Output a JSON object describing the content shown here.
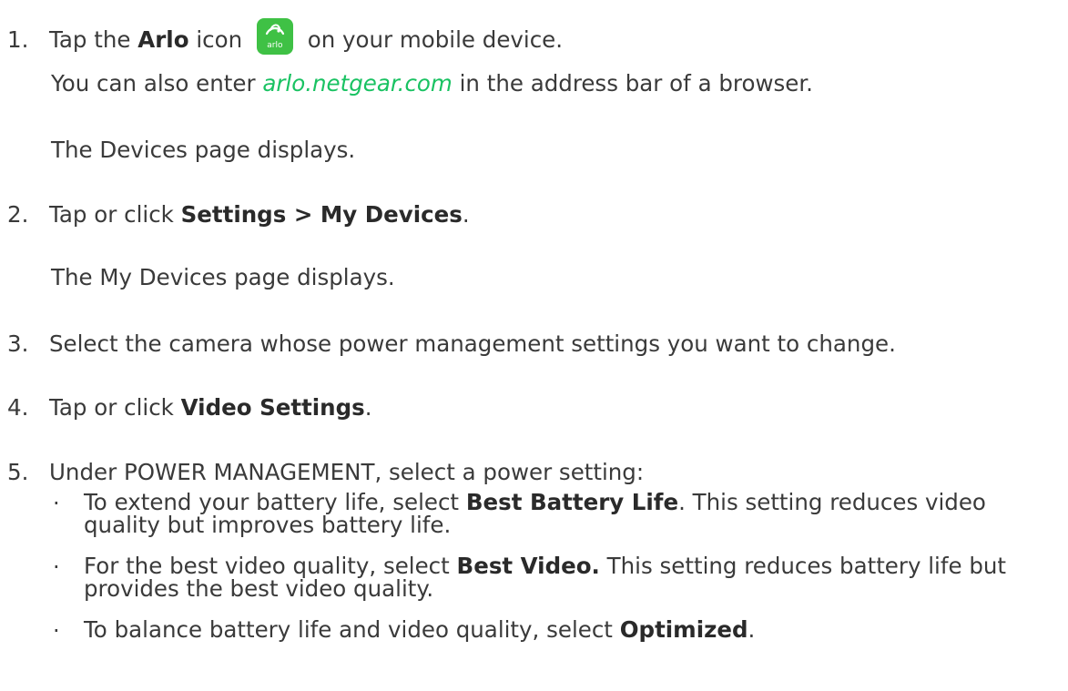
{
  "step1": {
    "number": "1.",
    "before": "Tap the ",
    "bold": "Arlo",
    "middle": " icon ",
    "icon_label": "arlo",
    "after": " on your mobile device.",
    "also_before": "You can also enter ",
    "also_link": "arlo.netgear.com",
    "also_after": " in the address bar of a browser.",
    "result": "The Devices  page displays."
  },
  "step2": {
    "number": "2.",
    "before": "Tap or click ",
    "bold": "Settings > My Devices",
    "after": ".",
    "result": "The My Devices page displays."
  },
  "step3": {
    "number": "3.",
    "text": "Select the camera whose power management settings you want to change."
  },
  "step4": {
    "number": "4.",
    "before": "Tap or click ",
    "bold": "Video Settings",
    "after": "."
  },
  "step5": {
    "number": "5.",
    "text": "Under POWER MANAGEMENT, select a power setting:",
    "bullets": [
      {
        "before": "To extend your battery life, select ",
        "bold": "Best Battery Life",
        "after": ". This setting reduces video quality but improves battery life."
      },
      {
        "before": "For the best video quality, select ",
        "bold": "Best Video.",
        "after": " This setting reduces battery life but provides the best video quality."
      },
      {
        "before": "To balance battery life and video quality, select ",
        "bold": "Optimized",
        "after": "."
      }
    ]
  },
  "colors": {
    "text": "#3a3a3a",
    "link": "#19c262",
    "icon_background": "#3fc145"
  },
  "icons": {
    "app_icon": "arlo-app-icon"
  }
}
